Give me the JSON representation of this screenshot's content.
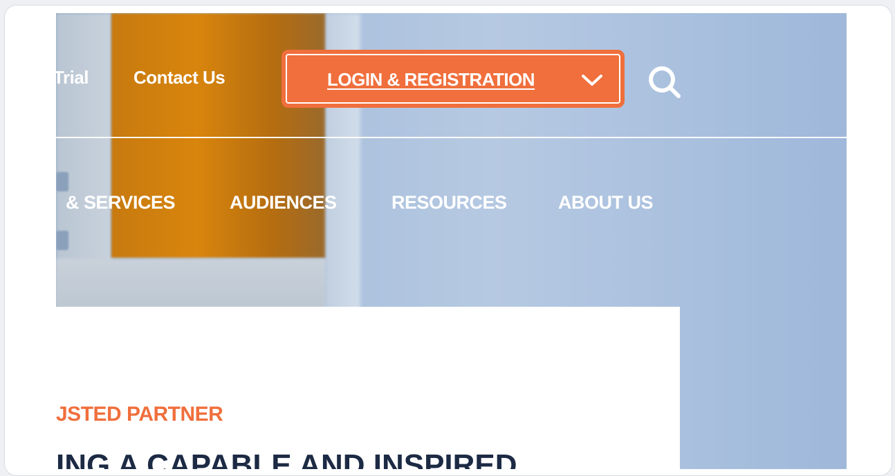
{
  "header": {
    "utility_links": [
      "Trial",
      "Contact Us"
    ],
    "login_button_label": "LOGIN & REGISTRATION"
  },
  "nav": {
    "items": [
      "& SERVICES",
      "AUDIENCES",
      "RESOURCES",
      "ABOUT US"
    ]
  },
  "content": {
    "eyebrow": "JSTED PARTNER",
    "headline": "ING A CAPABLE AND INSPIRED"
  },
  "colors": {
    "accent": "#f06f3c",
    "headline": "#1c2a44"
  },
  "icons": {
    "login_dropdown": "chevron-down-icon",
    "search": "search-icon"
  }
}
